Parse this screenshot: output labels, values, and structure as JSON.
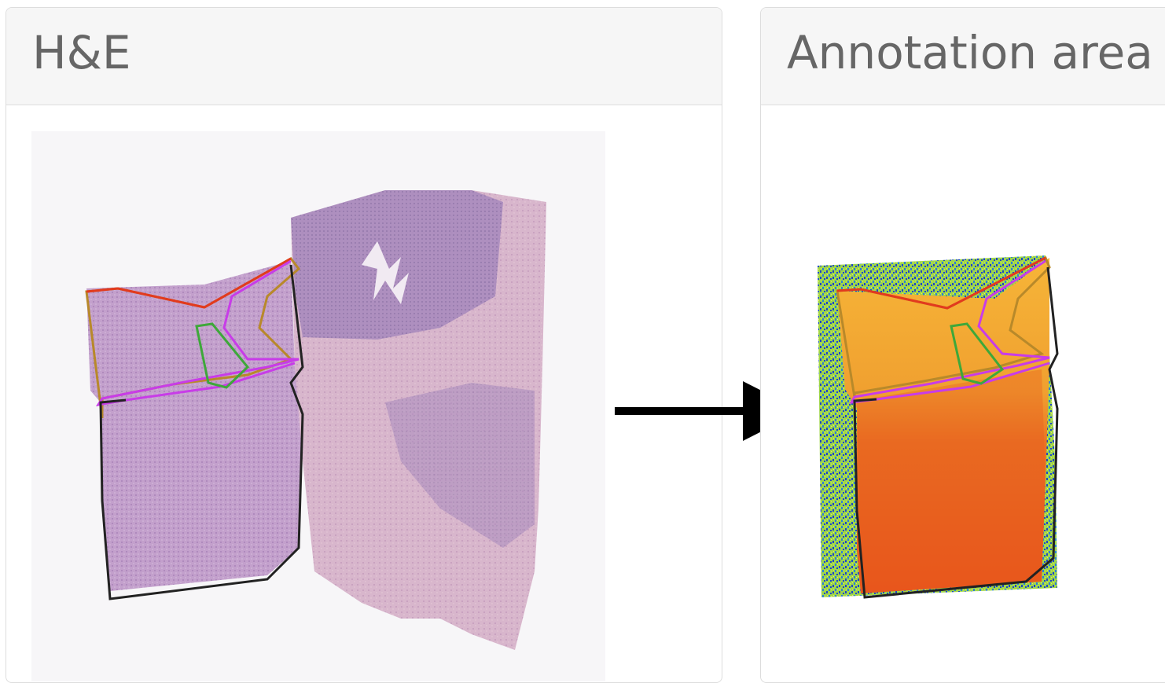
{
  "panels": {
    "left": {
      "title": "H&E"
    },
    "right": {
      "title": "Annotation area"
    }
  },
  "colors": {
    "tissue_he": "#c6a3cf",
    "tissue_he_pink": "#d9b2c8",
    "heatmap_orange": "#f0a030",
    "heatmap_red": "#e8561c",
    "background_noise": "#9fd64a",
    "annotation_black": "#222222",
    "annotation_red": "#e23a1e",
    "annotation_magenta": "#c83ce8",
    "annotation_olive": "#b8892a",
    "annotation_green": "#3ea83a"
  },
  "icons": {
    "transition_arrow": "arrow-right-icon"
  }
}
